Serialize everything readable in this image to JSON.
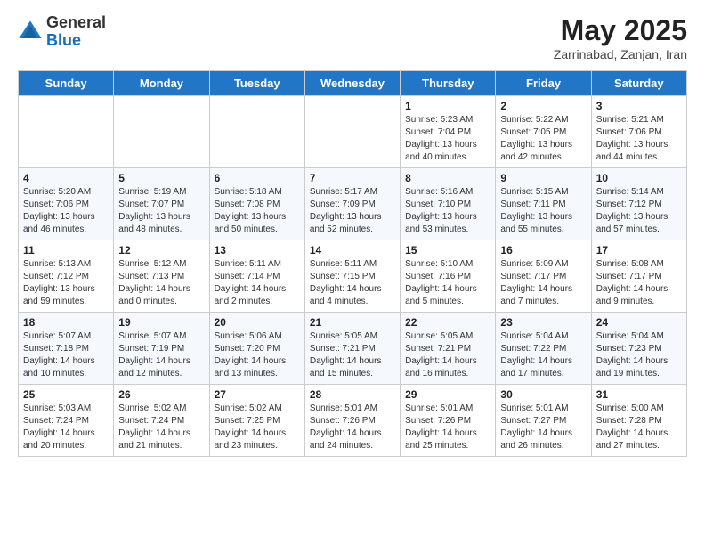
{
  "logo": {
    "general": "General",
    "blue": "Blue"
  },
  "title": {
    "month": "May 2025",
    "location": "Zarrinabad, Zanjan, Iran"
  },
  "weekdays": [
    "Sunday",
    "Monday",
    "Tuesday",
    "Wednesday",
    "Thursday",
    "Friday",
    "Saturday"
  ],
  "weeks": [
    [
      {
        "day": "",
        "info": ""
      },
      {
        "day": "",
        "info": ""
      },
      {
        "day": "",
        "info": ""
      },
      {
        "day": "",
        "info": ""
      },
      {
        "day": "1",
        "info": "Sunrise: 5:23 AM\nSunset: 7:04 PM\nDaylight: 13 hours\nand 40 minutes."
      },
      {
        "day": "2",
        "info": "Sunrise: 5:22 AM\nSunset: 7:05 PM\nDaylight: 13 hours\nand 42 minutes."
      },
      {
        "day": "3",
        "info": "Sunrise: 5:21 AM\nSunset: 7:06 PM\nDaylight: 13 hours\nand 44 minutes."
      }
    ],
    [
      {
        "day": "4",
        "info": "Sunrise: 5:20 AM\nSunset: 7:06 PM\nDaylight: 13 hours\nand 46 minutes."
      },
      {
        "day": "5",
        "info": "Sunrise: 5:19 AM\nSunset: 7:07 PM\nDaylight: 13 hours\nand 48 minutes."
      },
      {
        "day": "6",
        "info": "Sunrise: 5:18 AM\nSunset: 7:08 PM\nDaylight: 13 hours\nand 50 minutes."
      },
      {
        "day": "7",
        "info": "Sunrise: 5:17 AM\nSunset: 7:09 PM\nDaylight: 13 hours\nand 52 minutes."
      },
      {
        "day": "8",
        "info": "Sunrise: 5:16 AM\nSunset: 7:10 PM\nDaylight: 13 hours\nand 53 minutes."
      },
      {
        "day": "9",
        "info": "Sunrise: 5:15 AM\nSunset: 7:11 PM\nDaylight: 13 hours\nand 55 minutes."
      },
      {
        "day": "10",
        "info": "Sunrise: 5:14 AM\nSunset: 7:12 PM\nDaylight: 13 hours\nand 57 minutes."
      }
    ],
    [
      {
        "day": "11",
        "info": "Sunrise: 5:13 AM\nSunset: 7:12 PM\nDaylight: 13 hours\nand 59 minutes."
      },
      {
        "day": "12",
        "info": "Sunrise: 5:12 AM\nSunset: 7:13 PM\nDaylight: 14 hours\nand 0 minutes."
      },
      {
        "day": "13",
        "info": "Sunrise: 5:11 AM\nSunset: 7:14 PM\nDaylight: 14 hours\nand 2 minutes."
      },
      {
        "day": "14",
        "info": "Sunrise: 5:11 AM\nSunset: 7:15 PM\nDaylight: 14 hours\nand 4 minutes."
      },
      {
        "day": "15",
        "info": "Sunrise: 5:10 AM\nSunset: 7:16 PM\nDaylight: 14 hours\nand 5 minutes."
      },
      {
        "day": "16",
        "info": "Sunrise: 5:09 AM\nSunset: 7:17 PM\nDaylight: 14 hours\nand 7 minutes."
      },
      {
        "day": "17",
        "info": "Sunrise: 5:08 AM\nSunset: 7:17 PM\nDaylight: 14 hours\nand 9 minutes."
      }
    ],
    [
      {
        "day": "18",
        "info": "Sunrise: 5:07 AM\nSunset: 7:18 PM\nDaylight: 14 hours\nand 10 minutes."
      },
      {
        "day": "19",
        "info": "Sunrise: 5:07 AM\nSunset: 7:19 PM\nDaylight: 14 hours\nand 12 minutes."
      },
      {
        "day": "20",
        "info": "Sunrise: 5:06 AM\nSunset: 7:20 PM\nDaylight: 14 hours\nand 13 minutes."
      },
      {
        "day": "21",
        "info": "Sunrise: 5:05 AM\nSunset: 7:21 PM\nDaylight: 14 hours\nand 15 minutes."
      },
      {
        "day": "22",
        "info": "Sunrise: 5:05 AM\nSunset: 7:21 PM\nDaylight: 14 hours\nand 16 minutes."
      },
      {
        "day": "23",
        "info": "Sunrise: 5:04 AM\nSunset: 7:22 PM\nDaylight: 14 hours\nand 17 minutes."
      },
      {
        "day": "24",
        "info": "Sunrise: 5:04 AM\nSunset: 7:23 PM\nDaylight: 14 hours\nand 19 minutes."
      }
    ],
    [
      {
        "day": "25",
        "info": "Sunrise: 5:03 AM\nSunset: 7:24 PM\nDaylight: 14 hours\nand 20 minutes."
      },
      {
        "day": "26",
        "info": "Sunrise: 5:02 AM\nSunset: 7:24 PM\nDaylight: 14 hours\nand 21 minutes."
      },
      {
        "day": "27",
        "info": "Sunrise: 5:02 AM\nSunset: 7:25 PM\nDaylight: 14 hours\nand 23 minutes."
      },
      {
        "day": "28",
        "info": "Sunrise: 5:01 AM\nSunset: 7:26 PM\nDaylight: 14 hours\nand 24 minutes."
      },
      {
        "day": "29",
        "info": "Sunrise: 5:01 AM\nSunset: 7:26 PM\nDaylight: 14 hours\nand 25 minutes."
      },
      {
        "day": "30",
        "info": "Sunrise: 5:01 AM\nSunset: 7:27 PM\nDaylight: 14 hours\nand 26 minutes."
      },
      {
        "day": "31",
        "info": "Sunrise: 5:00 AM\nSunset: 7:28 PM\nDaylight: 14 hours\nand 27 minutes."
      }
    ]
  ]
}
